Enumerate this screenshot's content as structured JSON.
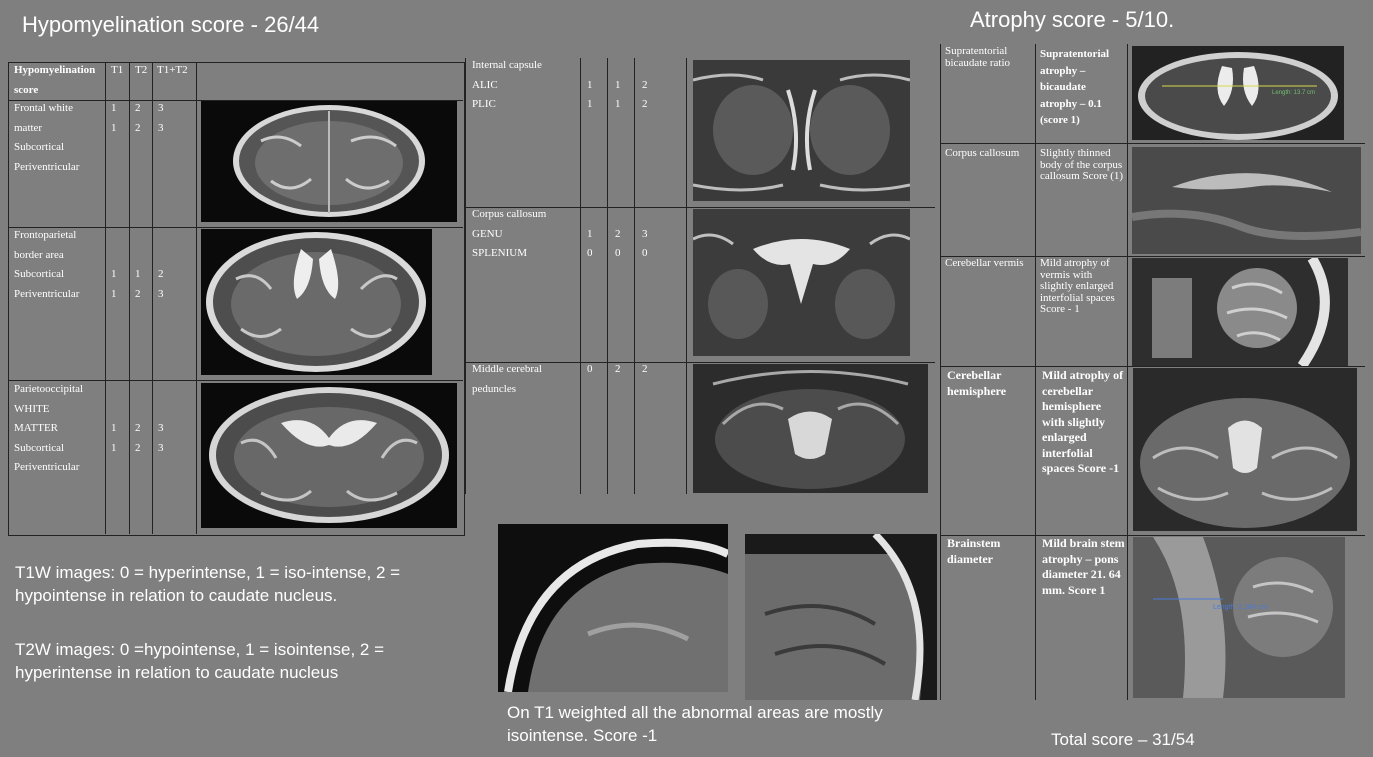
{
  "hypomyelination_title": "Hypomyelination score -  26/44",
  "atrophy_title": "Atrophy score -  5/10.",
  "left_table": {
    "headers": [
      "Hypomyelination score",
      "T1",
      "T2",
      "T1+T2"
    ],
    "rows": [
      {
        "labels": [
          "Frontal white",
          "matter",
          "Subcortical",
          "Periventricular"
        ],
        "t1": [
          "",
          "1",
          "1",
          ""
        ],
        "t2": [
          "",
          "2",
          "2",
          ""
        ],
        "t1t2": [
          "",
          "3",
          "3",
          ""
        ]
      },
      {
        "labels": [
          "Frontoparietal",
          "border area",
          "Subcortical",
          "Periventricular"
        ],
        "t1": [
          "",
          "",
          "1",
          "1"
        ],
        "t2": [
          "",
          "",
          "1",
          "2"
        ],
        "t1t2": [
          "",
          "",
          "2",
          "3"
        ]
      },
      {
        "labels": [
          "Parietooccipital",
          "WHITE",
          "MATTER",
          "Subcortical",
          "Periventricular"
        ],
        "t1": [
          "",
          "",
          "1",
          "1",
          ""
        ],
        "t2": [
          "",
          "",
          "2",
          "2",
          ""
        ],
        "t1t2": [
          "",
          "",
          "3",
          "3",
          ""
        ]
      }
    ]
  },
  "mid_table": {
    "rows": [
      {
        "labels": [
          "Internal capsule",
          "ALIC",
          "PLIC"
        ],
        "t1": [
          "",
          "1",
          "1"
        ],
        "t2": [
          "",
          "1",
          "1"
        ],
        "t1t2": [
          "",
          "2",
          "2"
        ]
      },
      {
        "labels": [
          "Corpus callosum",
          "GENU",
          "SPLENIUM"
        ],
        "t1": [
          "",
          "1",
          "0"
        ],
        "t2": [
          "",
          "2",
          "0"
        ],
        "t1t2": [
          "",
          "3",
          "0"
        ]
      },
      {
        "labels": [
          "Middle cerebral",
          "peduncles"
        ],
        "t1": [
          "0",
          ""
        ],
        "t2": [
          "2",
          ""
        ],
        "t1t2": [
          "2",
          ""
        ]
      }
    ]
  },
  "right_table": {
    "rows": [
      {
        "label": "Supratentorial bicaudate ratio",
        "desc": "Supratentorial atrophy – bicaudate atrophy – 0.1 (score 1)",
        "bold": true
      },
      {
        "label": "Corpus callosum",
        "desc": "Slightly thinned body of the corpus callosum  Score (1)",
        "bold": false
      },
      {
        "label": "Cerebellar vermis",
        "desc": "Mild atrophy of vermis with slightly enlarged interfolial spaces Score - 1",
        "bold": false
      },
      {
        "label": "Cerebellar hemisphere",
        "desc": "Mild atrophy of cerebellar hemisphere with slightly enlarged interfolial spaces Score -1",
        "bold": true
      },
      {
        "label": "Brainstem diameter",
        "desc": "Mild brain stem atrophy – pons diameter 21. 64 mm. Score 1",
        "bold": true
      }
    ],
    "measure_label_1": "Length: 13.7 cm",
    "measure_label_2": "Length: 2.164 cm"
  },
  "notes": {
    "t1w": "T1W images: 0 =  hyperintense, 1 =  iso-intense, 2 = hypointense in relation to caudate nucleus.",
    "t2w": "T2W images: 0 =hypointense, 1 = isointense, 2 = hyperintense in relation to caudate nucleus",
    "t1_weighted": "On T1 weighted all the abnormal areas are mostly isointense. Score -1"
  },
  "total_score": "Total score – 31/54"
}
